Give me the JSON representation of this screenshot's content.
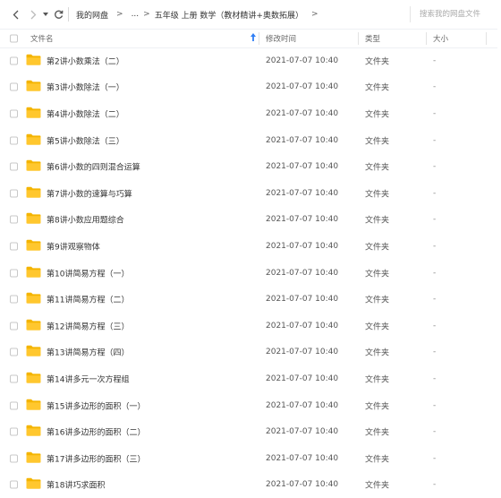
{
  "breadcrumb": {
    "root": "我的网盘",
    "sep1": ">",
    "ellipsis": "...",
    "current": "五年级 上册 数学（教材精讲+奥数拓展）",
    "sep2": ">",
    "sep3": ">"
  },
  "search": {
    "placeholder": "搜索我的网盘文件",
    "value": ""
  },
  "columns": {
    "name": "文件名",
    "sort_icon": "sort-asc-arrow-icon",
    "modified": "修改时间",
    "type": "类型",
    "size": "大小"
  },
  "colors": {
    "folder": "#ffc72e",
    "folder_dark": "#f4b400",
    "sort_arrow": "#2f7ef5"
  },
  "files": [
    {
      "name": "第2讲小数乘法（二）",
      "modified": "2021-07-07 10:40",
      "type": "文件夹",
      "size": "-"
    },
    {
      "name": "第3讲小数除法（一）",
      "modified": "2021-07-07 10:40",
      "type": "文件夹",
      "size": "-"
    },
    {
      "name": "第4讲小数除法（二）",
      "modified": "2021-07-07 10:40",
      "type": "文件夹",
      "size": "-"
    },
    {
      "name": "第5讲小数除法（三）",
      "modified": "2021-07-07 10:40",
      "type": "文件夹",
      "size": "-"
    },
    {
      "name": "第6讲小数的四则混合运算",
      "modified": "2021-07-07 10:40",
      "type": "文件夹",
      "size": "-"
    },
    {
      "name": "第7讲小数的速算与巧算",
      "modified": "2021-07-07 10:40",
      "type": "文件夹",
      "size": "-"
    },
    {
      "name": "第8讲小数应用题综合",
      "modified": "2021-07-07 10:40",
      "type": "文件夹",
      "size": "-"
    },
    {
      "name": "第9讲观察物体",
      "modified": "2021-07-07 10:40",
      "type": "文件夹",
      "size": "-"
    },
    {
      "name": "第10讲简易方程（一）",
      "modified": "2021-07-07 10:40",
      "type": "文件夹",
      "size": "-"
    },
    {
      "name": "第11讲简易方程（二）",
      "modified": "2021-07-07 10:40",
      "type": "文件夹",
      "size": "-"
    },
    {
      "name": "第12讲简易方程（三）",
      "modified": "2021-07-07 10:40",
      "type": "文件夹",
      "size": "-"
    },
    {
      "name": "第13讲简易方程（四）",
      "modified": "2021-07-07 10:40",
      "type": "文件夹",
      "size": "-"
    },
    {
      "name": "第14讲多元一次方程组",
      "modified": "2021-07-07 10:40",
      "type": "文件夹",
      "size": "-"
    },
    {
      "name": "第15讲多边形的面积（一）",
      "modified": "2021-07-07 10:40",
      "type": "文件夹",
      "size": "-"
    },
    {
      "name": "第16讲多边形的面积（二）",
      "modified": "2021-07-07 10:40",
      "type": "文件夹",
      "size": "-"
    },
    {
      "name": "第17讲多边形的面积（三）",
      "modified": "2021-07-07 10:40",
      "type": "文件夹",
      "size": "-"
    },
    {
      "name": "第18讲巧求面积",
      "modified": "2021-07-07 10:40",
      "type": "文件夹",
      "size": "-"
    }
  ]
}
